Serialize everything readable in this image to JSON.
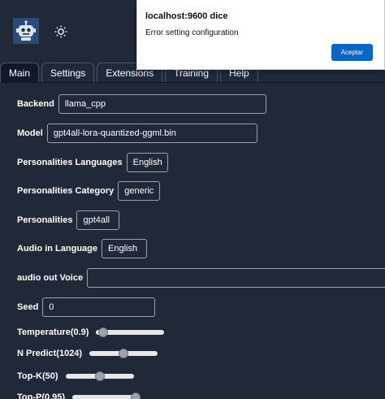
{
  "header": {
    "logo_icon": "robot-icon",
    "theme_icon": "sun-icon"
  },
  "tabs": [
    {
      "label": "Main",
      "active": true
    },
    {
      "label": "Settings"
    },
    {
      "label": "Extensions"
    },
    {
      "label": "Training"
    },
    {
      "label": "Help"
    }
  ],
  "form": {
    "backend": {
      "label": "Backend",
      "value": "llama_cpp"
    },
    "model": {
      "label": "Model",
      "value": "gpt4all-lora-quantized-ggml.bin"
    },
    "personalities_languages": {
      "label": "Personalities Languages",
      "value": "English"
    },
    "personalities_category": {
      "label": "Personalities Category",
      "value": "generic"
    },
    "personalities": {
      "label": "Personalities",
      "value": "gpt4all"
    },
    "audio_in_language": {
      "label": "Audio in Language",
      "value": "English"
    },
    "audio_out_voice": {
      "label": "audio out Voice",
      "value": ""
    },
    "seed": {
      "label": "Seed",
      "value": "0"
    },
    "temperature": {
      "label": "Temperature(0.9)",
      "fraction": 0.1
    },
    "n_predict": {
      "label": "N Predict(1024)",
      "fraction": 0.5
    },
    "top_k": {
      "label": "Top-K(50)",
      "fraction": 0.5
    },
    "top_p": {
      "label": "Top-P(0.95)",
      "fraction": 0.95
    }
  },
  "dialog": {
    "title": "localhost:9600 dice",
    "message": "Error setting configuration",
    "button_label": "Aceptar"
  },
  "colors": {
    "background": "#1f2937",
    "accent_button": "#0a66c2"
  }
}
